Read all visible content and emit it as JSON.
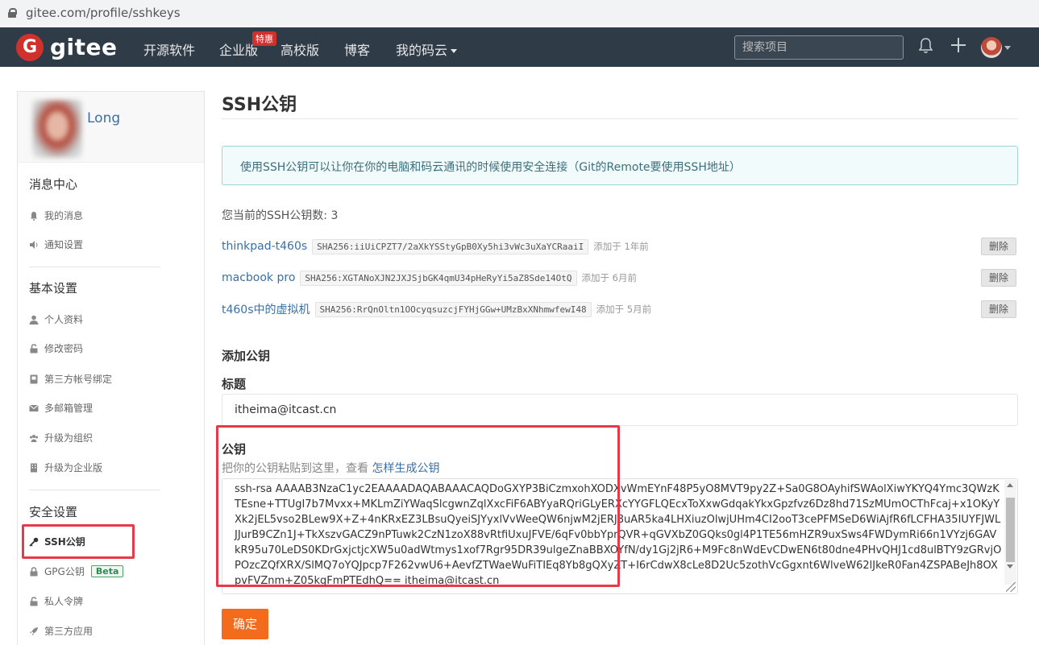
{
  "browser": {
    "url": "gitee.com/profile/sshkeys"
  },
  "nav": {
    "logo_mark": "G",
    "logo_text": "gitee",
    "items": [
      "开源软件",
      "企业版",
      "高校版",
      "博客",
      "我的码云"
    ],
    "hot_badge": "特惠",
    "search_placeholder": "搜索项目"
  },
  "sidebar": {
    "username": "Long",
    "sections": [
      {
        "title": "消息中心",
        "items": [
          "我的消息",
          "通知设置"
        ]
      },
      {
        "title": "基本设置",
        "items": [
          "个人资料",
          "修改密码",
          "第三方帐号绑定",
          "多邮箱管理",
          "升级为组织",
          "升级为企业版"
        ]
      },
      {
        "title": "安全设置",
        "items": [
          "SSH公钥",
          "GPG公钥",
          "私人令牌",
          "第三方应用"
        ]
      }
    ],
    "beta_badge": "Beta"
  },
  "main": {
    "title": "SSH公钥",
    "info": "使用SSH公钥可以让你在你的电脑和码云通讯的时候使用安全连接（Git的Remote要使用SSH地址）",
    "key_count": "您当前的SSH公钥数: 3",
    "keys": [
      {
        "name": "thinkpad-t460s",
        "fingerprint": "SHA256:iiUiCPZT7/2aXkYSStyGpB0Xy5hi3vWc3uXaYCRaaiI",
        "added": "添加于 1年前",
        "delete": "删除"
      },
      {
        "name": "macbook pro",
        "fingerprint": "SHA256:XGTANoXJN2JXJSjbGK4qmU34pHeRyYi5aZ8Sde14OtQ",
        "added": "添加于 6月前",
        "delete": "删除"
      },
      {
        "name": "t460s中的虚拟机",
        "fingerprint": "SHA256:RrQnOltn1OOcyqsuzcjFYHjGGw+UMzBxXNhmwfewI48",
        "added": "添加于 5月前",
        "delete": "删除"
      }
    ],
    "add_heading": "添加公钥",
    "title_label": "标题",
    "title_value": "itheima@itcast.cn",
    "key_label": "公钥",
    "key_hint_prefix": "把你的公钥粘贴到这里，查看",
    "key_hint_link": "怎样生成公钥",
    "key_value": "ssh-rsa AAAAB3NzaC1yc2EAAAADAQABAAACAQDoGXYP3BiCzmxohXODXvWmEYnF48P5yO8MVT9py2Z+Sa0G8OAyhifSWAolXiwYKYQ4Ymc3QWzKTEsne+TTUgI7b7Mvxx+MKLmZiYWaqSlcgwnZqlXxcFiF6ABYyaRQriGLyERXcYYGFLQEcxToXxwGdqakYkxGpzfvz6Dz8hd71SzMUmOCThFcaj+x1OKyYXk2jEL5vso2BLew9X+Z+4nKRxEZ3LBsuQyeiSJYyxlVvWeeQW6njwM2jERJ8uAR5ka4LHXiuzOlwjUHm4CI2ooT3cePFMSeD6WiAjfR6fLCFHA35IUYFJWLJJurB9CZn1J+TkXszvGACZ9nPTuwk2CzN1zoX88vRtfiUxuJFVE/6qFv0bbYprQVR+qGVXbZ0GQks0gl4P1TE56mHZR9uxSws4FWDymRi66n1VYzj6GAVkR95u70LeDS0KDrGxjctjcXW5u0adWtmys1xof7Rgr95DR39ulgeZnaBBXOYfN/dy1Gj2jR6+M9Fc8nWdEvCDwEN6t80dne4PHvQHJ1cd8ulBTY9zGRvjOPOzcZQfXRX/SlMQ7oYQJpcp7F262vwU6+AevfZTWaeWuFiTIEq8Yb8gQXyZT+I6rCdwX8cLe8D2Uc5zothVcGgxnt6WlveW62lJkeR0Fan4ZSPABeJh8OXpvFVZnm+Z05kgFmPTEdhQ== itheima@itcast.cn",
    "confirm": "确定"
  },
  "colors": {
    "nav_bg": "#2f3b47",
    "accent_orange": "#f36b1c",
    "link_blue": "#3a6fa4",
    "highlight_red": "#e8394a"
  }
}
